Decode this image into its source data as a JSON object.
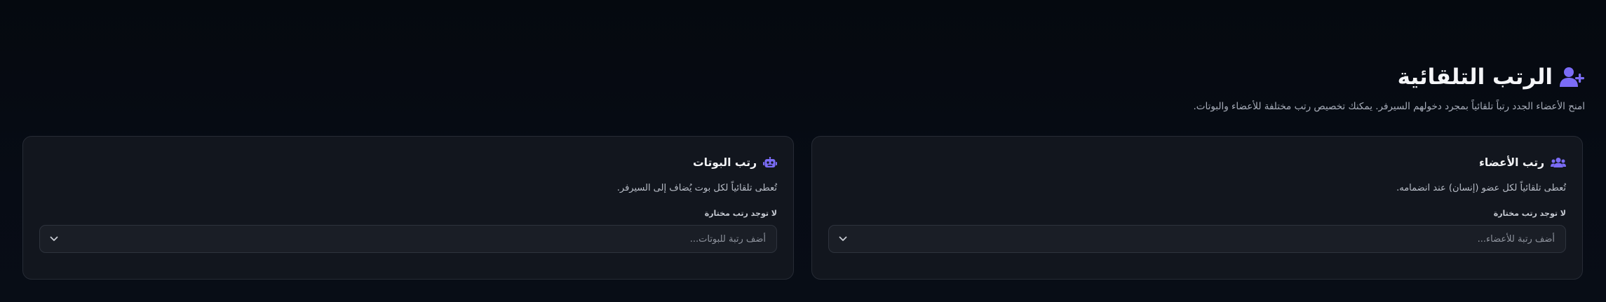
{
  "header": {
    "title": "الرتب التلقائية",
    "icon": "user-plus-icon",
    "description": "امنح الأعضاء الجدد رتباً تلقائياً بمجرد دخولهم السيرفر. يمكنك تخصيص رتب مختلفة للأعضاء والبوتات."
  },
  "colors": {
    "accent": "#7b6cf6",
    "background": "#060b14",
    "card": "#12161e"
  },
  "cards": {
    "members": {
      "icon": "users-icon",
      "title": "رتب الأعضاء",
      "description": "تُعطى تلقائياً لكل عضو (إنسان) عند انضمامه.",
      "selected_label": "لا توجد رتب مختارة",
      "placeholder": "أضف رتبة للأعضاء..."
    },
    "bots": {
      "icon": "robot-icon",
      "title": "رتب البوتات",
      "description": "تُعطى تلقائياً لكل بوت يُضاف إلى السيرفر.",
      "selected_label": "لا توجد رتب مختارة",
      "placeholder": "أضف رتبة للبوتات..."
    }
  }
}
